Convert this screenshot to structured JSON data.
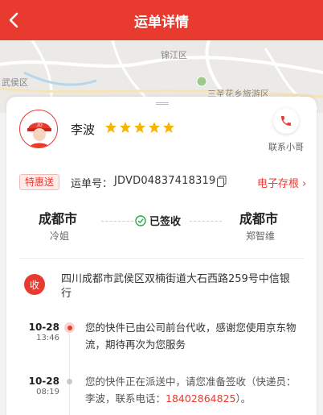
{
  "header": {
    "title": "运单详情"
  },
  "map": {
    "labels": [
      "锦江区",
      "三圣花乡旅游区",
      "武侯区"
    ]
  },
  "courier": {
    "name": "李波",
    "rating": 5,
    "contact_label": "联系小哥",
    "avatar_text": "JD"
  },
  "waybill": {
    "badge": "特惠送",
    "number_label": "运单号：",
    "number": "JDVD04837418319",
    "estub_label": "电子存根 ›",
    "from_city": "成都市",
    "from_person": "冷姐",
    "status": "已签收",
    "to_city": "成都市",
    "to_person": "郑智维"
  },
  "address": {
    "icon_text": "收",
    "text": "四川成都市武侯区双楠街道大石西路259号中信银行"
  },
  "tracking": [
    {
      "date": "10-28",
      "time": "13:46",
      "text": "您的快件已由公司前台代收，感谢您使用京东物流，期待再次为您服务"
    },
    {
      "date": "10-28",
      "time": "08:19",
      "text_prefix": "您的快件正在派送中，请您准备签收（快递员：李波，联系电话：",
      "phone": "18402864825",
      "text_suffix": "）。"
    }
  ],
  "colors": {
    "brand": "#e93a30",
    "star": "#f7b500"
  }
}
